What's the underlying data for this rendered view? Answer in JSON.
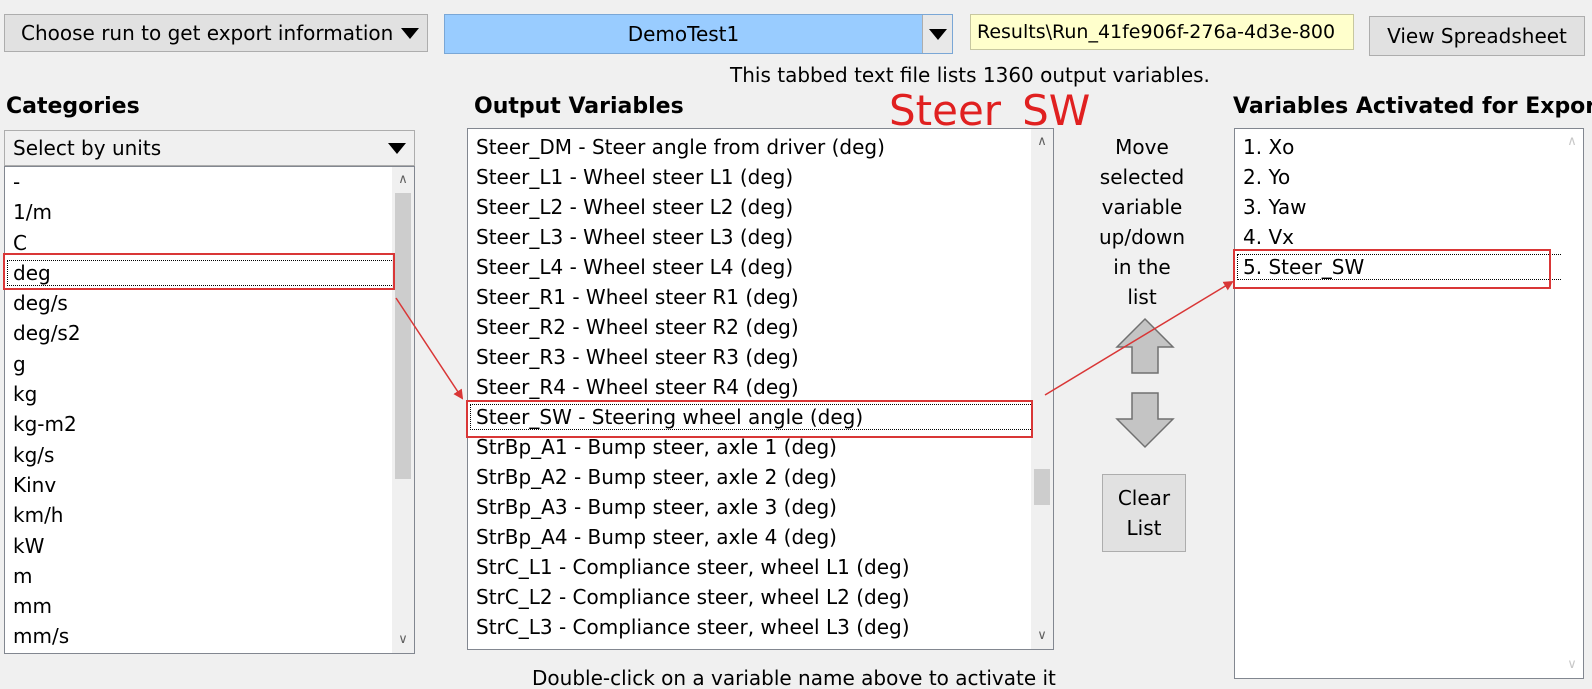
{
  "toolbar": {
    "run_select": "Choose run to get export information",
    "test_select": "DemoTest1",
    "results_path": "Results\\Run_41fe906f-276a-4d3e-800",
    "view_button": "View Spreadsheet"
  },
  "info_line": "This tabbed text file lists 1360 output variables.",
  "categories": {
    "heading": "Categories",
    "filter": "Select by units",
    "items": [
      "-",
      "1/m",
      "C",
      "deg",
      "deg/s",
      "deg/s2",
      "g",
      "kg",
      "kg-m2",
      "kg/s",
      "Kinv",
      "km/h",
      "kW",
      "m",
      "mm",
      "mm/s"
    ],
    "selected": "deg"
  },
  "output_variables": {
    "heading": "Output Variables",
    "items": [
      "Steer_DM - Steer angle from driver (deg)",
      "Steer_L1 - Wheel steer L1 (deg)",
      "Steer_L2 - Wheel steer L2 (deg)",
      "Steer_L3 - Wheel steer L3 (deg)",
      "Steer_L4 - Wheel steer L4 (deg)",
      "Steer_R1 - Wheel steer R1 (deg)",
      "Steer_R2 - Wheel steer R2 (deg)",
      "Steer_R3 - Wheel steer R3 (deg)",
      "Steer_R4 - Wheel steer R4 (deg)",
      "Steer_SW - Steering wheel angle (deg)",
      "StrBp_A1 - Bump steer, axle 1 (deg)",
      "StrBp_A2 - Bump steer, axle 2 (deg)",
      "StrBp_A3 - Bump steer, axle 3 (deg)",
      "StrBp_A4 - Bump steer, axle 4 (deg)",
      "StrC_L1 - Compliance steer, wheel L1 (deg)",
      "StrC_L2 - Compliance steer, wheel L2 (deg)",
      "StrC_L3 - Compliance steer, wheel L3 (deg)"
    ],
    "selected": "Steer_SW - Steering wheel angle (deg)"
  },
  "selected_variable_label": "Steer_SW",
  "move_text": [
    "Move",
    "selected",
    "variable",
    "up/down",
    "in the list"
  ],
  "clear_button": [
    "Clear",
    "List"
  ],
  "export": {
    "heading": "Variables Activated for Export",
    "items": [
      "1. Xo",
      "2. Yo",
      "3. Yaw",
      "4. Vx",
      "5. Steer_SW"
    ],
    "selected": "5. Steer_SW"
  },
  "footer": "Double-click on a variable name above to activate it",
  "colors": {
    "highlight": "#d93636",
    "test_select_bg": "#99ccff",
    "path_bg": "#ffffcc"
  },
  "icons": {
    "dropdown": "triangle-down",
    "move_up": "up-arrow",
    "move_down": "down-arrow",
    "scroll_up": "chevron-up",
    "scroll_down": "chevron-down"
  }
}
